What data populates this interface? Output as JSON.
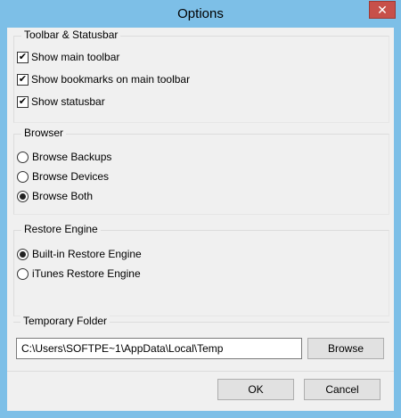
{
  "window": {
    "title": "Options",
    "close_glyph": "✕"
  },
  "toolbar_group": {
    "title": "Toolbar & Statusbar",
    "items": [
      {
        "label": "Show main toolbar",
        "checked": true
      },
      {
        "label": "Show bookmarks on main toolbar",
        "checked": true
      },
      {
        "label": "Show statusbar",
        "checked": true
      }
    ]
  },
  "browser_group": {
    "title": "Browser",
    "options": [
      {
        "label": "Browse Backups",
        "selected": false
      },
      {
        "label": "Browse Devices",
        "selected": false
      },
      {
        "label": "Browse Both",
        "selected": true
      }
    ]
  },
  "restore_group": {
    "title": "Restore Engine",
    "options": [
      {
        "label": "Built-in Restore Engine",
        "selected": true
      },
      {
        "label": "iTunes Restore Engine",
        "selected": false
      }
    ]
  },
  "temp_group": {
    "title": "Temporary Folder",
    "path_value": "C:\\Users\\SOFTPE~1\\AppData\\Local\\Temp",
    "browse_label": "Browse"
  },
  "footer": {
    "ok_label": "OK",
    "cancel_label": "Cancel"
  },
  "icons": {
    "check": "✔"
  },
  "colors": {
    "frame": "#7dbfe7",
    "close": "#c7504a",
    "client_bg": "#f0f0f0"
  }
}
